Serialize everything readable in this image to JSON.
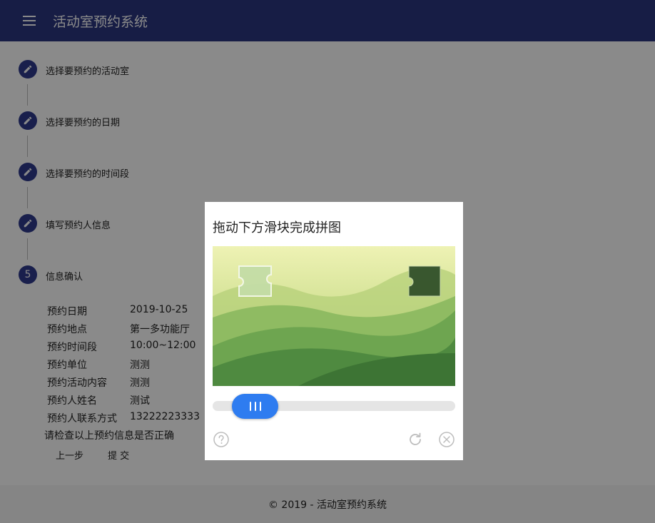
{
  "app": {
    "title": "活动室预约系统"
  },
  "steps": [
    {
      "label": "选择要预约的活动室"
    },
    {
      "label": "选择要预约的日期"
    },
    {
      "label": "选择要预约的时间段"
    },
    {
      "label": "填写预约人信息"
    },
    {
      "label": "信息确认",
      "number": "5"
    }
  ],
  "confirm": {
    "rows": [
      {
        "key": "预约日期",
        "value": "2019-10-25"
      },
      {
        "key": "预约地点",
        "value": "第一多功能厅"
      },
      {
        "key": "预约时间段",
        "value": "10:00~12:00"
      },
      {
        "key": "预约单位",
        "value": "测测"
      },
      {
        "key": "预约活动内容",
        "value": "测测"
      },
      {
        "key": "预约人姓名",
        "value": "测试"
      },
      {
        "key": "预约人联系方式",
        "value": "13222223333"
      }
    ],
    "check_text": "请检查以上预约信息是否正确",
    "prev_button": "上一步",
    "submit_button": "提 交"
  },
  "footer": {
    "text": "© 2019 - 活动室预约系统"
  },
  "captcha": {
    "title": "拖动下方滑块完成拼图",
    "slider_progress": 0.08,
    "icons": {
      "help": "help-circle-icon",
      "refresh": "refresh-icon",
      "close": "close-circle-icon"
    }
  },
  "colors": {
    "appbar": "#2b3780",
    "step_circle": "#2f3a8c",
    "slider_handle": "#2e7cf0"
  }
}
